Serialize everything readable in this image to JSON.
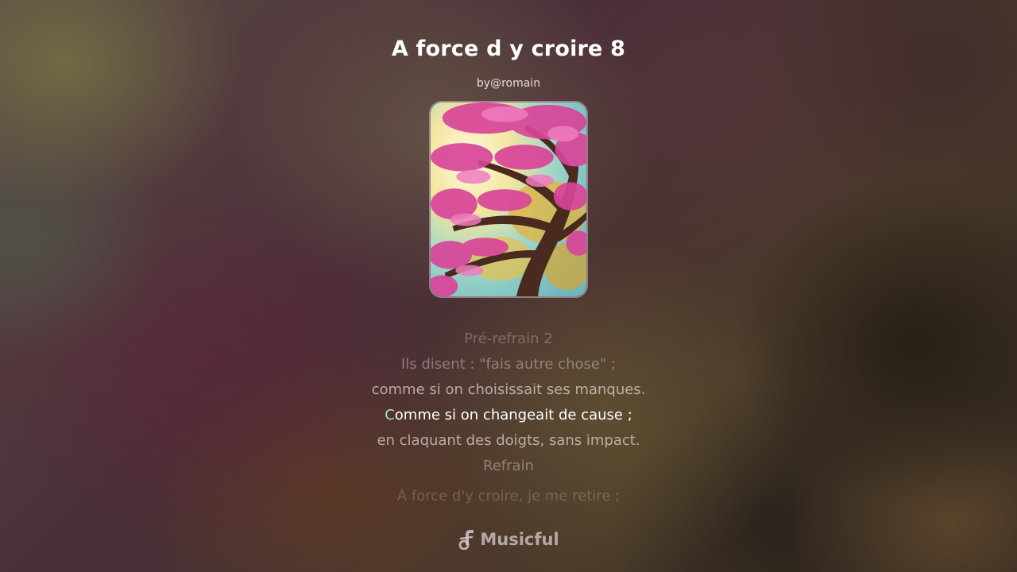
{
  "song": {
    "title": "A force d y croire 8",
    "author": "by@romain"
  },
  "cover": {
    "alt": "cherry-blossom-tree-artwork"
  },
  "lyrics": {
    "lines": [
      "Pré-refrain 2",
      "Ils disent : \"fais autre chose\" ;",
      "comme si on choisissait ses manques.",
      "Comme si on changeait de cause ;",
      "en claquant des doigts, sans impact.",
      "Refrain",
      "À force d'y croire, je me retire ;"
    ],
    "active_line_first_char": "C",
    "active_line_rest": "omme si on changeait de cause ;",
    "highlight_color": "#9be8a8"
  },
  "brand": {
    "name": "Musicful",
    "icon": "music-note-icon"
  }
}
